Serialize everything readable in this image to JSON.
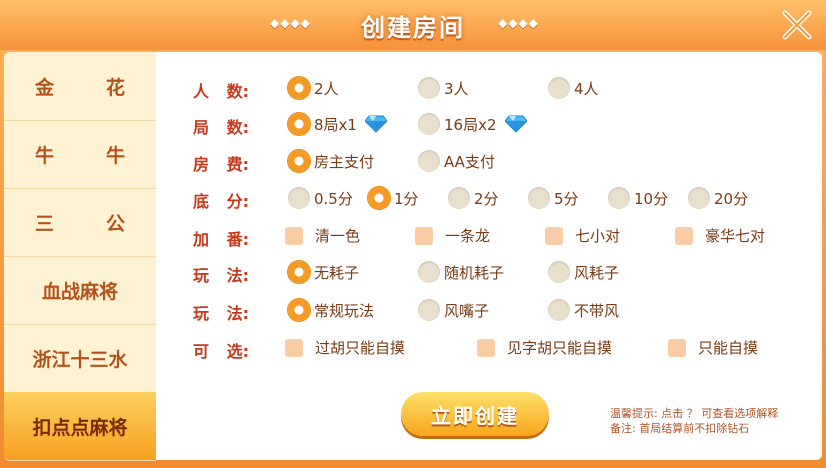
{
  "title": "创建房间",
  "deco_left": "◆◆◆◆",
  "deco_right": "◆◆◆◆",
  "sidebar": {
    "items": [
      {
        "chars": [
          "金",
          "花"
        ]
      },
      {
        "chars": [
          "牛",
          "牛"
        ]
      },
      {
        "chars": [
          "三",
          "公"
        ]
      },
      {
        "label": "血战麻将"
      },
      {
        "label": "浙江十三水"
      },
      {
        "label": "扣点点麻将"
      }
    ]
  },
  "rows": [
    {
      "label": [
        "人",
        "数:"
      ],
      "options": [
        {
          "text": "2人",
          "selected": true
        },
        {
          "text": "3人"
        },
        {
          "text": "4人"
        }
      ]
    },
    {
      "label": [
        "局",
        "数:"
      ],
      "options": [
        {
          "text": "8局x1",
          "selected": true,
          "gem": true
        },
        {
          "text": "16局x2",
          "gem": true
        }
      ]
    },
    {
      "label": [
        "房",
        "费:"
      ],
      "options": [
        {
          "text": "房主支付",
          "selected": true
        },
        {
          "text": "AA支付"
        }
      ]
    },
    {
      "label": [
        "底",
        "分:"
      ],
      "options": [
        {
          "text": "0.5分"
        },
        {
          "text": "1分",
          "selected": true
        },
        {
          "text": "2分"
        },
        {
          "text": "5分"
        },
        {
          "text": "10分"
        },
        {
          "text": "20分"
        }
      ]
    },
    {
      "label": [
        "加",
        "番:"
      ],
      "options": [
        {
          "text": "清一色"
        },
        {
          "text": "一条龙"
        },
        {
          "text": "七小对"
        },
        {
          "text": "豪华七对"
        }
      ]
    },
    {
      "label": [
        "玩",
        "法:"
      ],
      "options": [
        {
          "text": "无耗子",
          "selected": true
        },
        {
          "text": "随机耗子"
        },
        {
          "text": "风耗子"
        }
      ]
    },
    {
      "label": [
        "玩",
        "法:"
      ],
      "options": [
        {
          "text": "常规玩法",
          "selected": true
        },
        {
          "text": "风嘴子"
        },
        {
          "text": "不带风"
        }
      ]
    },
    {
      "label": [
        "可",
        "选:"
      ],
      "options": [
        {
          "text": "过胡只能自摸"
        },
        {
          "text": "见字胡只能自摸"
        },
        {
          "text": "只能自摸"
        }
      ]
    }
  ],
  "create_button": "立即创建",
  "notes": {
    "line1": "温馨提示: 点击 ？ 可查看选项解释",
    "line2": "备注: 首局结算前不扣除钻石"
  },
  "colors": {
    "accent": "#f59a22",
    "label": "#c7391a",
    "text": "#7a3c16"
  }
}
